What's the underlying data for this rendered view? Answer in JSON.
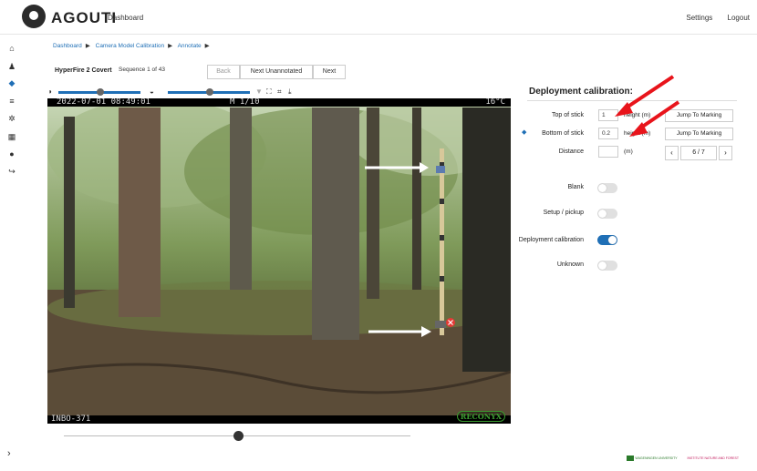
{
  "app": {
    "title": "AGOUTI",
    "nav_link": "Dashboard",
    "settings": "Settings",
    "logout": "Logout"
  },
  "breadcrumb": [
    "Dashboard",
    "Camera Model Calibration",
    "Annotate"
  ],
  "camera": {
    "name": "HyperFire 2 Covert",
    "sequence": "Sequence 1 of 43"
  },
  "buttons": {
    "back": "Back",
    "next_unannotated": "Next Unannotated",
    "next": "Next"
  },
  "image_overlay": {
    "top_left": "2022-07-01 08:49:01",
    "top_mid": "M 1/10",
    "top_right": "16°C",
    "bottom_left": "INBO-371",
    "brand": "RECONYX"
  },
  "panel": {
    "title": "Deployment calibration:",
    "top_of_stick": {
      "label": "Top of stick",
      "value": "1",
      "unit": "height (m)",
      "jump": "Jump To Marking"
    },
    "bottom_of_stick": {
      "label": "Bottom of stick",
      "value": "0.2",
      "unit": "height (m)",
      "jump": "Jump To Marking"
    },
    "distance": {
      "label": "Distance",
      "value": "",
      "unit": "(m)",
      "page": "6 / 7"
    },
    "toggles": [
      {
        "label": "Blank",
        "on": false
      },
      {
        "label": "Setup / pickup",
        "on": false
      },
      {
        "label": "Deployment calibration",
        "on": true
      },
      {
        "label": "Unknown",
        "on": false
      }
    ]
  },
  "colors": {
    "accent": "#1f6fb6",
    "arrow": "#e8141b"
  },
  "footer": {
    "logo1": "WAGENINGEN UNIVERSITY",
    "logo2": "INSTITUTE NATURE AND FOREST"
  }
}
